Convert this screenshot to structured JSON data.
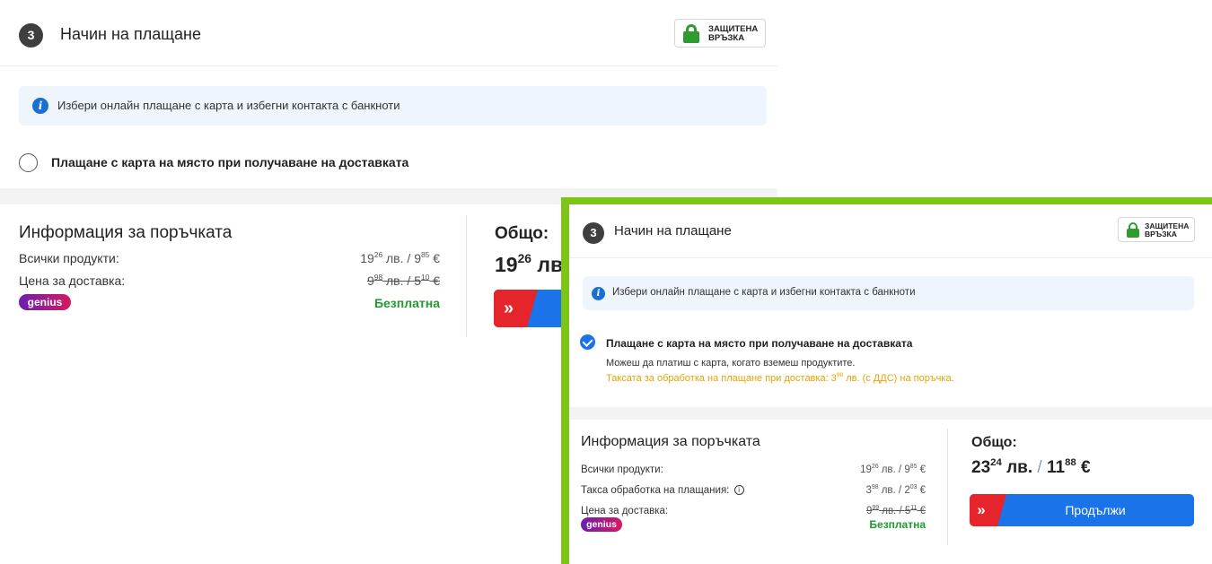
{
  "colors": {
    "accent_blue": "#1a73e8",
    "brand_red": "#e5242b",
    "free_green": "#1f9b30",
    "fee_orange": "#e8a300",
    "highlight_frame": "#7dc618",
    "secure_green": "#2e9b2e"
  },
  "left": {
    "step_number": "3",
    "step_title": "Начин на плащане",
    "secure_badge": {
      "line1": "ЗАЩИТЕНА",
      "line2": "ВРЪЗКА",
      "icon": "lock-icon"
    },
    "info_text": "Избери онлайн плащане с карта и избегни контакта с банкноти",
    "payment_option_label": "Плащане с карта на място при получаване на доставката",
    "payment_option_selected": false,
    "order_info": {
      "title": "Информация за поръчката",
      "products_label": "Всички продукти:",
      "products_value": {
        "bgn_int": "19",
        "bgn_dec": "26",
        "bgn_unit": " лв. / ",
        "eur_int": "9",
        "eur_dec": "85",
        "eur_unit": " €"
      },
      "delivery_label": "Цена за доставка:",
      "delivery_value": {
        "bgn_int": "9",
        "bgn_dec": "98",
        "bgn_unit": " лв. / ",
        "eur_int": "5",
        "eur_dec": "10",
        "eur_unit": " €"
      },
      "genius_label": "genius",
      "free_label": "Безплатна"
    },
    "total": {
      "label": "Общо:",
      "int": "19",
      "dec": "26",
      "unit": " лв"
    }
  },
  "right": {
    "step_number": "3",
    "step_title": "Начин на плащане",
    "secure_badge": {
      "line1": "ЗАЩИТЕНА",
      "line2": "ВРЪЗКА",
      "icon": "lock-icon"
    },
    "info_text": "Избери онлайн плащане с карта и избегни контакта с банкноти",
    "payment_option_label": "Плащане с карта на място при получаване на доставката",
    "payment_option_selected": true,
    "payment_option_desc": "Можеш да платиш с карта, когато вземеш продуктите.",
    "payment_fee_note": {
      "before": "Таксата за обработка на плащане при доставка: 3",
      "sup": "98",
      "after": " лв. (с ДДС) на поръчка."
    },
    "order_info": {
      "title": "Информация за поръчката",
      "products_label": "Всички продукти:",
      "products_value": {
        "bgn_int": "19",
        "bgn_dec": "26",
        "bgn_unit": " лв. / ",
        "eur_int": "9",
        "eur_dec": "85",
        "eur_unit": " €"
      },
      "fee_label": "Такса обработка на плащания:",
      "fee_value": {
        "bgn_int": "3",
        "bgn_dec": "98",
        "bgn_unit": " лв. / ",
        "eur_int": "2",
        "eur_dec": "03",
        "eur_unit": " €"
      },
      "delivery_label": "Цена за доставка:",
      "delivery_value": {
        "bgn_int": "9",
        "bgn_dec": "99",
        "bgn_unit": " лв. / ",
        "eur_int": "5",
        "eur_dec": "11",
        "eur_unit": " €"
      },
      "genius_label": "genius",
      "free_label": "Безплатна"
    },
    "total": {
      "label": "Общо:",
      "bgn_int": "23",
      "bgn_dec": "24",
      "bgn_unit": " лв.",
      "sep": " / ",
      "eur_int": "11",
      "eur_dec": "88",
      "eur_unit": " €"
    },
    "continue_label": "Продължи"
  }
}
